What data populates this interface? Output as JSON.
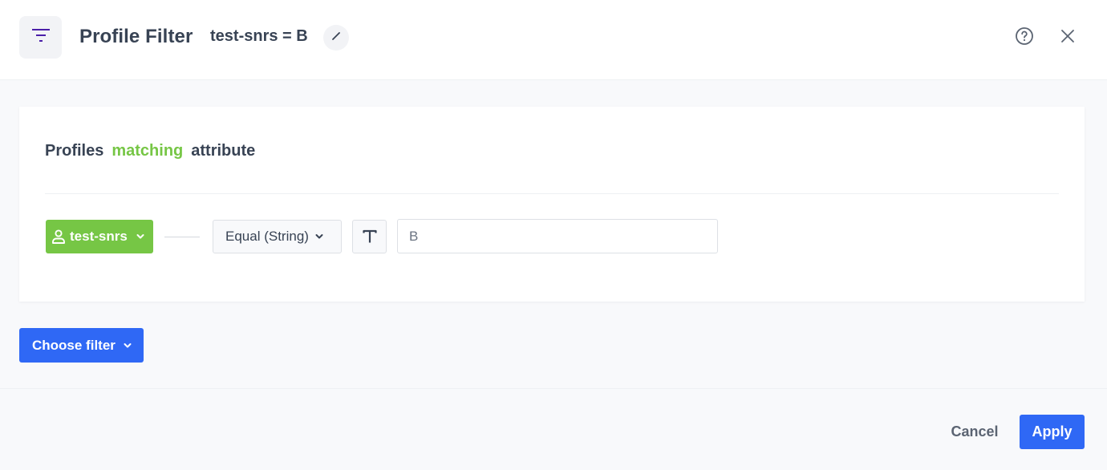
{
  "header": {
    "icon": "filter-icon",
    "title": "Profile Filter",
    "subtitle": "test-snrs = B",
    "edit_icon": "pencil-icon",
    "help_icon": "question-circle-icon",
    "close_icon": "close-icon"
  },
  "card": {
    "heading": {
      "prefix": "Profiles",
      "accent": "matching",
      "suffix": "attribute"
    },
    "condition": {
      "attribute_icon": "user-icon",
      "attribute_label": "test-snrs",
      "operator_label": "Equal (String)",
      "type_icon": "text-type-icon",
      "value": "B"
    }
  },
  "actions": {
    "choose_filter_label": "Choose filter",
    "cancel_label": "Cancel",
    "apply_label": "Apply"
  },
  "colors": {
    "brand_purple": "#4b1fa8",
    "accent_green": "#76c645",
    "primary_blue": "#2f68f5",
    "text_dark": "#384354"
  }
}
